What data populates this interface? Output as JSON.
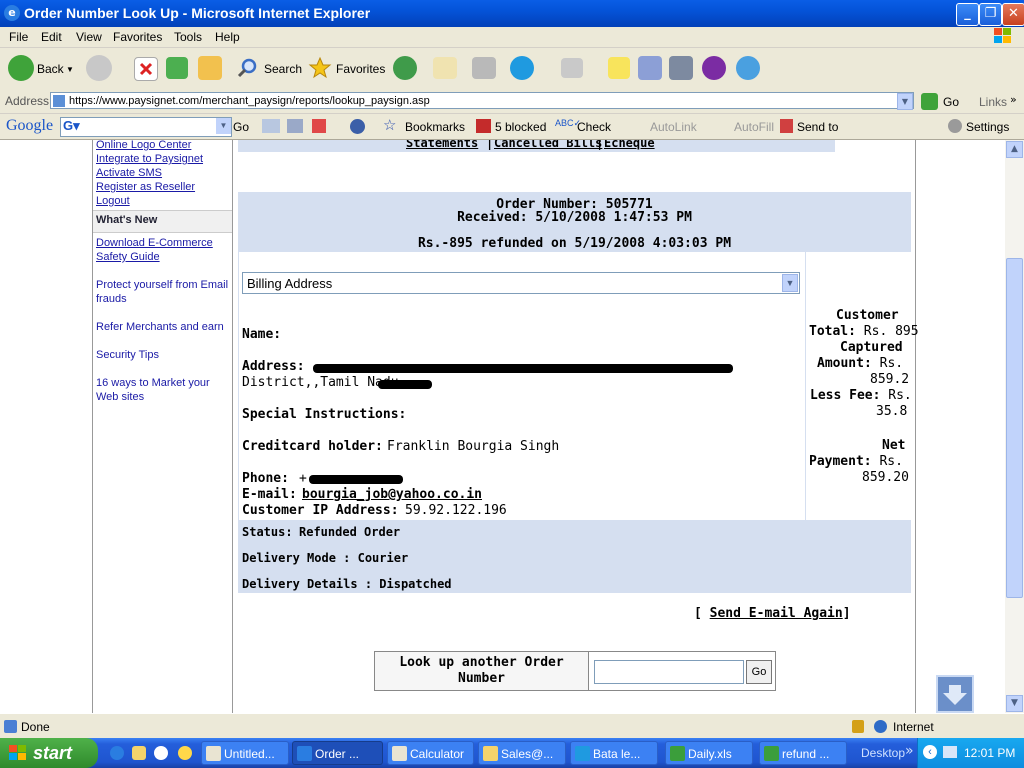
{
  "window": {
    "title": "Order Number Look Up - Microsoft Internet Explorer",
    "minimize": "_",
    "maximize": "❐",
    "close": "✕"
  },
  "menu": [
    "File",
    "Edit",
    "View",
    "Favorites",
    "Tools",
    "Help"
  ],
  "toolbar": {
    "back": "Back",
    "search": "Search",
    "favorites": "Favorites"
  },
  "address": {
    "label": "Address",
    "url": "https://www.paysignet.com/merchant_paysign/reports/lookup_paysign.asp",
    "go": "Go",
    "links": "Links"
  },
  "google": {
    "logo": "Google",
    "go": "Go",
    "bookmarks": "Bookmarks",
    "blocked": "5 blocked",
    "check": "Check",
    "autolink": "AutoLink",
    "autofill": "AutoFill",
    "sendto": "Send to",
    "settings": "Settings"
  },
  "leftnav": {
    "links_top": [
      "Online Logo Center",
      "Integrate to Paysignet",
      "Activate SMS",
      "Register as Reseller",
      "Logout"
    ],
    "whats_new": "What's New",
    "links_news": [
      "Download E-Commerce Safety Guide",
      "Protect yourself from Email frauds",
      "Refer Merchants and earn",
      "Security Tips",
      "16 ways to Market your Web sites"
    ]
  },
  "topstrip": {
    "statements": "Statements",
    "cancelled": "Cancelled Bills",
    "echeque": "Echeque"
  },
  "order": {
    "number_line": "Order Number: 505771",
    "received_line": "Received: 5/10/2008 1:47:53 PM",
    "refund_line": "Rs.-895 refunded on 5/19/2008 4:03:03 PM",
    "address_select": "Billing Address",
    "name_label": "Name:",
    "address_label": "Address:",
    "address_line2": "District,,Tamil Nadu,",
    "special_label": "Special Instructions:",
    "cardholder_label": "Creditcard holder:",
    "cardholder_value": "Franklin Bourgia Singh",
    "phone_label": "Phone:",
    "phone_prefix": "+",
    "email_label": "E-mail:",
    "email_value": "bourgia_job@yahoo.co.in",
    "ip_label": "Customer IP Address:",
    "ip_value": "59.92.122.196"
  },
  "summary": {
    "customer": "Customer",
    "total_label": "Total:",
    "total_value": "Rs. 895",
    "captured": "Captured",
    "amount_label": "Amount:",
    "amount_rs": "Rs.",
    "amount_value": "859.2",
    "fee_label": "Less Fee:",
    "fee_rs": "Rs.",
    "fee_value": "35.8",
    "net": "Net",
    "payment_label": "Payment:",
    "payment_rs": "Rs.",
    "payment_value": "859.20"
  },
  "status": {
    "status_label": "Status:",
    "status_value": "Refunded Order",
    "delivery_mode": "Delivery Mode : Courier",
    "delivery_details": "Delivery Details : Dispatched"
  },
  "actions": {
    "bracket_open": "[",
    "send_email": "Send E-mail Again",
    "bracket_close": "]",
    "lookup_label": "Look up another Order Number",
    "lookup_value": "",
    "lookup_go": "Go"
  },
  "statusbar": {
    "text": "Done",
    "zone": "Internet"
  },
  "taskbar": {
    "start": "start",
    "tasks": [
      "Untitled...",
      "Order ...",
      "Calculator",
      "Sales@...",
      "Bata le...",
      "Daily.xls",
      "refund ..."
    ],
    "desktop": "Desktop",
    "clock": "12:01 PM"
  }
}
